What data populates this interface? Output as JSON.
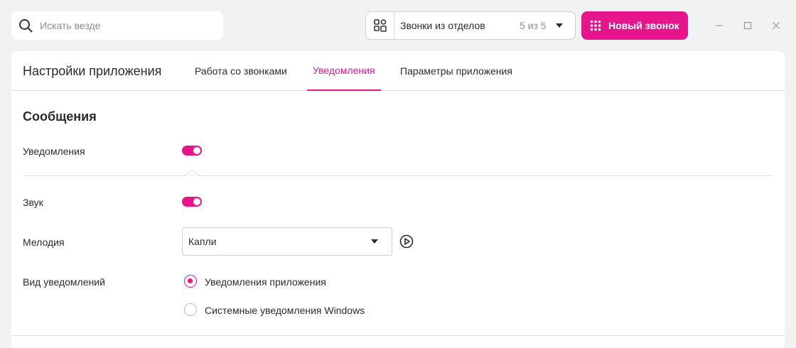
{
  "search": {
    "placeholder": "Искать везде"
  },
  "departments": {
    "label": "Звонки из отделов",
    "count": "5 из 5"
  },
  "new_call": {
    "label": "Новый звонок"
  },
  "window": {
    "icons": [
      "minimize-icon",
      "maximize-icon",
      "close-icon"
    ]
  },
  "settings": {
    "title": "Настройки приложения",
    "tabs": [
      {
        "label": "Работа со звонками",
        "active": false
      },
      {
        "label": "Уведомления",
        "active": true
      },
      {
        "label": "Параметры приложения",
        "active": false
      }
    ],
    "section_title": "Сообщения",
    "notifications": {
      "label": "Уведомления",
      "enabled": true
    },
    "sound": {
      "label": "Звук",
      "enabled": true
    },
    "melody": {
      "label": "Мелодия",
      "value": "Капли"
    },
    "notification_type": {
      "label": "Вид уведомлений",
      "options": [
        {
          "label": "Уведомления приложения",
          "selected": true
        },
        {
          "label": "Системные уведомления Windows",
          "selected": false
        }
      ]
    }
  },
  "colors": {
    "accent": "#e6158c",
    "background": "#f1f2f2",
    "panel": "#ffffff"
  }
}
